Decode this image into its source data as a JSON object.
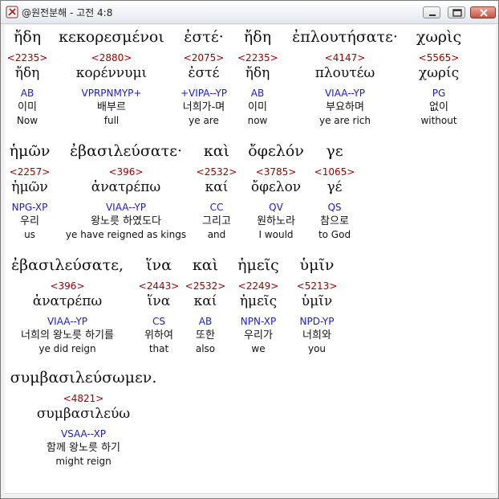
{
  "window": {
    "title": "@원전분해 - 고전 4:8"
  },
  "verse": [
    [
      {
        "greek": "ἤδη",
        "num": "<2235>",
        "lemma": "ἤδη",
        "parse": "AB",
        "korean": "이미",
        "english": "Now"
      },
      {
        "greek": "κεκορεσμένοι",
        "num": "<2880>",
        "lemma": "κορέννυμι",
        "parse": "VPRPNMYP+",
        "korean": "배부르",
        "english": "full"
      },
      {
        "greek": "ἐστέ·",
        "num": "<2075>",
        "lemma": "ἐστέ",
        "parse": "+VIPA--YP",
        "korean": "너희가-며",
        "english": "ye are"
      },
      {
        "greek": "ἤδη",
        "num": "<2235>",
        "lemma": "ἤδη",
        "parse": "AB",
        "korean": "이미",
        "english": "now"
      },
      {
        "greek": "ἐπλουτήσατε·",
        "num": "<4147>",
        "lemma": "πλουτέω",
        "parse": "VIAA--YP",
        "korean": "부요하며",
        "english": "ye are rich"
      },
      {
        "greek": "χωρὶς",
        "num": "<5565>",
        "lemma": "χωρίς",
        "parse": "PG",
        "korean": "없이",
        "english": "without"
      }
    ],
    [
      {
        "greek": "ἡμῶν",
        "num": "<2257>",
        "lemma": "ἡμῶν",
        "parse": "NPG-XP",
        "korean": "우리",
        "english": "us"
      },
      {
        "greek": "ἐβασιλεύσατε·",
        "num": "<396>",
        "lemma": "ἀνατρέπω",
        "parse": "VIAA--YP",
        "korean": "왕노릇 하였도다",
        "english": "ye have reigned as kings"
      },
      {
        "greek": "καὶ",
        "num": "<2532>",
        "lemma": "καί",
        "parse": "CC",
        "korean": "그리고",
        "english": "and"
      },
      {
        "greek": "ὄφελόν",
        "num": "<3785>",
        "lemma": "ὄφελον",
        "parse": "QV",
        "korean": "원하노라",
        "english": "I would"
      },
      {
        "greek": "γε",
        "num": "<1065>",
        "lemma": "γέ",
        "parse": "QS",
        "korean": "참으로",
        "english": "to God"
      }
    ],
    [
      {
        "greek": "ἐβασιλεύσατε,",
        "num": "<396>",
        "lemma": "ἀνατρέπω",
        "parse": "VIAA--YP",
        "korean": "너희의 왕노릇 하기를",
        "english": "ye did reign"
      },
      {
        "greek": "ἵνα",
        "num": "<2443>",
        "lemma": "ἵνα",
        "parse": "CS",
        "korean": "위하여",
        "english": "that"
      },
      {
        "greek": "καὶ",
        "num": "<2532>",
        "lemma": "καί",
        "parse": "AB",
        "korean": "또한",
        "english": "also"
      },
      {
        "greek": "ἡμεῖς",
        "num": "<2249>",
        "lemma": "ἡμεῖς",
        "parse": "NPN-XP",
        "korean": "우리가",
        "english": "we"
      },
      {
        "greek": "ὑμῖν",
        "num": "<5213>",
        "lemma": "ὑμῖν",
        "parse": "NPD-YP",
        "korean": "너희와",
        "english": "you"
      }
    ],
    [
      {
        "greek": "συμβασιλεύσωμεν.",
        "num": "<4821>",
        "lemma": "συμβασιλεύω",
        "parse": "VSAA--XP",
        "korean": "함께 왕노릇 하기",
        "english": "might reign"
      }
    ]
  ]
}
